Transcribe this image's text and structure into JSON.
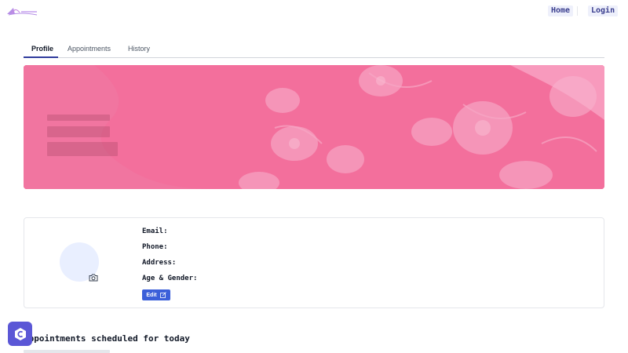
{
  "nav": {
    "home_label": "Home",
    "login_label": "Login"
  },
  "tabs": [
    {
      "label": "Profile",
      "active": true
    },
    {
      "label": "Appointments",
      "active": false
    },
    {
      "label": "History",
      "active": false
    }
  ],
  "profile": {
    "email_label": "Email:",
    "phone_label": "Phone:",
    "address_label": "Address:",
    "age_gender_label": "Age & Gender:",
    "edit_label": "Edit"
  },
  "appointments": {
    "title": "Appointments scheduled for today"
  },
  "colors": {
    "banner": "#f36f9c",
    "accent": "#3b5fd9",
    "fab": "#5b57d6"
  },
  "icons": {
    "logo": "logo-icon",
    "camera": "camera-icon",
    "edit": "edit-icon",
    "chat": "chat-icon"
  }
}
